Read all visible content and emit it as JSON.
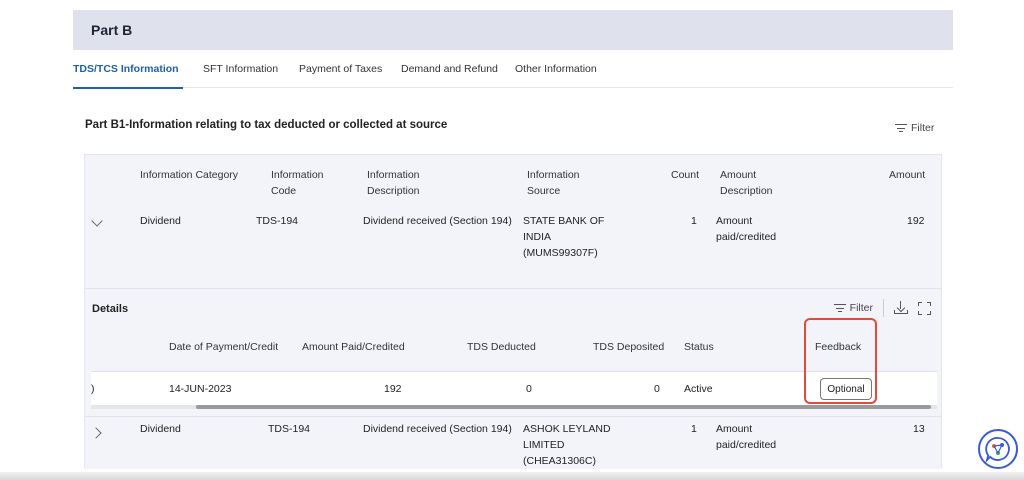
{
  "card": {
    "title": "Part B"
  },
  "tabs": [
    {
      "label": "TDS/TCS Information",
      "active": true
    },
    {
      "label": "SFT Information"
    },
    {
      "label": "Payment of Taxes"
    },
    {
      "label": "Demand and Refund"
    },
    {
      "label": "Other Information"
    }
  ],
  "section": {
    "title": "Part B1-Information relating to tax deducted or collected at source",
    "filter_label": "Filter"
  },
  "main_table": {
    "headers": {
      "category": "Information Category",
      "code": "Information Code",
      "description": "Information Description",
      "source": "Information Source",
      "count": "Count",
      "amount_description": "Amount Description",
      "amount": "Amount"
    },
    "rows": [
      {
        "category": "Dividend",
        "code": "TDS-194",
        "description": "Dividend received (Section 194)",
        "source": "STATE BANK OF INDIA (MUMS99307F)",
        "count": "1",
        "amount_description": "Amount paid/credited",
        "amount": "192"
      },
      {
        "category": "Dividend",
        "code": "TDS-194",
        "description": "Dividend received (Section 194)",
        "source": "ASHOK LEYLAND LIMITED (CHEA31306C)",
        "count": "1",
        "amount_description": "Amount paid/credited",
        "amount": "13"
      }
    ]
  },
  "details": {
    "title": "Details",
    "filter_label": "Filter",
    "headers": {
      "date": "Date of Payment/Credit",
      "amount_paid": "Amount Paid/Credited",
      "tds_deducted": "TDS Deducted",
      "tds_deposited": "TDS Deposited",
      "status": "Status",
      "feedback": "Feedback"
    },
    "row": {
      "cut_off_cell": ")",
      "date": "14-JUN-2023",
      "amount_paid": "192",
      "tds_deducted": "0",
      "tds_deposited": "0",
      "status": "Active",
      "feedback_button": "Optional"
    }
  },
  "colors": {
    "accent": "#1f5fa8",
    "header_bg": "#dfe1ec",
    "highlight": "#e24a3a"
  }
}
